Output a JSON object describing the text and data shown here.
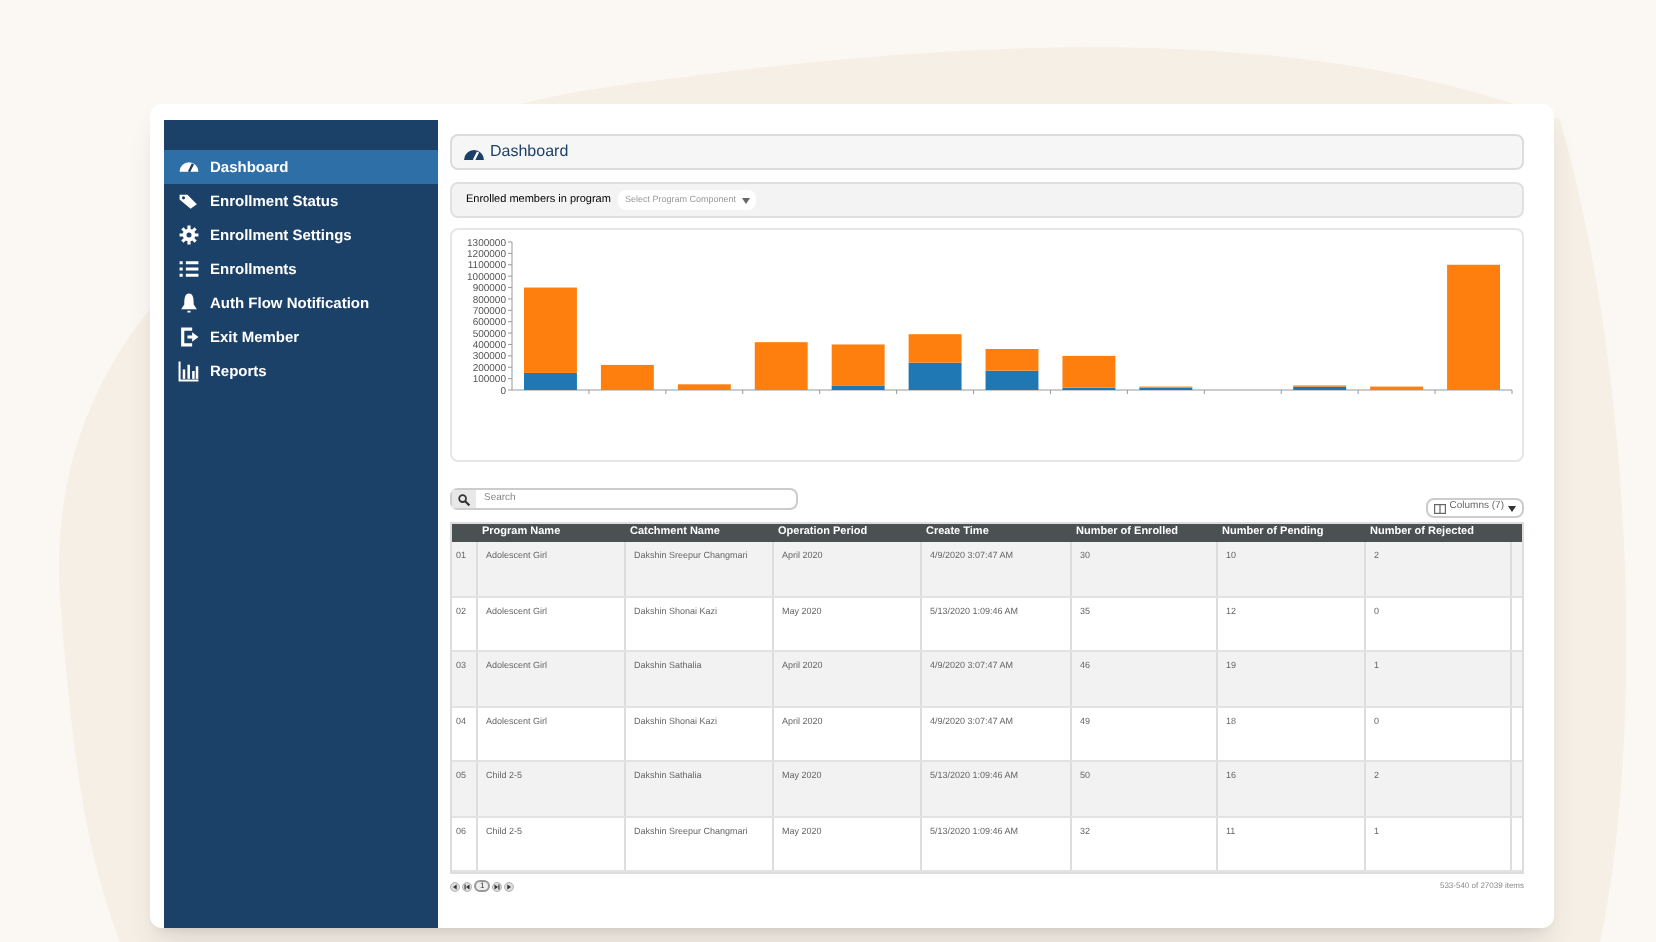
{
  "sidebar": {
    "items": [
      {
        "label": "Dashboard",
        "selected": true
      },
      {
        "label": "Enrollment Status",
        "selected": false
      },
      {
        "label": "Enrollment Settings",
        "selected": false
      },
      {
        "label": "Enrollments",
        "selected": false
      },
      {
        "label": "Auth Flow Notification",
        "selected": false
      },
      {
        "label": "Exit Member",
        "selected": false
      },
      {
        "label": "Reports",
        "selected": false
      }
    ]
  },
  "header": {
    "title": "Dashboard"
  },
  "filter": {
    "label": "Enrolled members in program",
    "select": {
      "placeholder": "Select Program Component"
    }
  },
  "chart": {
    "chart_data": {
      "type": "bar",
      "stacked": true,
      "yticks": [
        {
          "value": 0,
          "label": "0"
        },
        {
          "value": 100000,
          "label": "100000"
        },
        {
          "value": 200000,
          "label": "200000"
        },
        {
          "value": 300000,
          "label": "300000"
        },
        {
          "value": 400000,
          "label": "400000"
        },
        {
          "value": 500000,
          "label": "500000"
        },
        {
          "value": 600000,
          "label": "600000"
        },
        {
          "value": 700000,
          "label": "700000"
        },
        {
          "value": 800000,
          "label": "800000"
        },
        {
          "value": 900000,
          "label": "900000"
        },
        {
          "value": 1000000,
          "label": "1000000"
        },
        {
          "value": 1100000,
          "label": "1100000"
        },
        {
          "value": 1200000,
          "label": "1200000"
        },
        {
          "value": 1300000,
          "label": "1300000"
        }
      ],
      "ylim": [
        0,
        1300000
      ],
      "series": [
        {
          "color": "#1f77b4",
          "values": [
            150000,
            0,
            0,
            0,
            40000,
            240000,
            170000,
            20000,
            20000,
            0,
            30000,
            0,
            0
          ]
        },
        {
          "color": "#ff7f0e",
          "values": [
            750000,
            220000,
            50000,
            420000,
            360000,
            250000,
            190000,
            280000,
            10000,
            0,
            10000,
            30000,
            1100000
          ]
        }
      ]
    }
  },
  "search": {
    "placeholder": "Search"
  },
  "columns_button": {
    "label": "Columns (7)"
  },
  "table": {
    "columns": [
      "Program Name",
      "Catchment Name",
      "Operation Period",
      "Create Time",
      "Number of Enrolled",
      "Number of Pending",
      "Number of Rejected"
    ],
    "rows": [
      {
        "index": "01",
        "cells": [
          "Adolescent Girl",
          "Dakshin Sreepur Changmari",
          "April 2020",
          "4/9/2020 3:07:47 AM",
          "30",
          "10",
          "2"
        ]
      },
      {
        "index": "02",
        "cells": [
          "Adolescent Girl",
          "Dakshin Shonai Kazi",
          "May 2020",
          "5/13/2020 1:09:46 AM",
          "35",
          "12",
          "0"
        ]
      },
      {
        "index": "03",
        "cells": [
          "Adolescent Girl",
          "Dakshin Sathalia",
          "April 2020",
          "4/9/2020 3:07:47 AM",
          "46",
          "19",
          "1"
        ]
      },
      {
        "index": "04",
        "cells": [
          "Adolescent Girl",
          "Dakshin Shonai Kazi",
          "April 2020",
          "4/9/2020 3:07:47 AM",
          "49",
          "18",
          "0"
        ]
      },
      {
        "index": "05",
        "cells": [
          "Child 2-5",
          "Dakshin Sathalia",
          "May 2020",
          "5/13/2020 1:09:46 AM",
          "50",
          "16",
          "2"
        ]
      },
      {
        "index": "06",
        "cells": [
          "Child 2-5",
          "Dakshin Sreepur Changmari",
          "May 2020",
          "5/13/2020 1:09:46 AM",
          "32",
          "11",
          "1"
        ]
      }
    ]
  },
  "pager": {
    "page": "1",
    "summary": "533-540 of 27039 items"
  }
}
